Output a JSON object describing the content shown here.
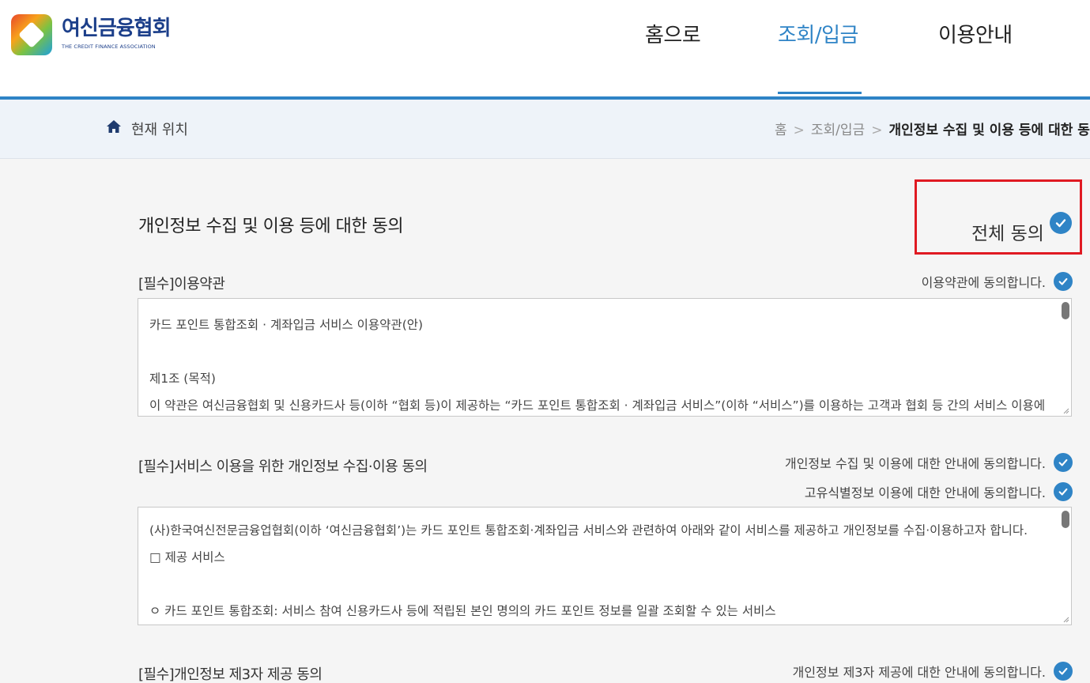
{
  "logo": {
    "name_ko": "여신금융협회",
    "name_en": "THE CREDIT FINANCE ASSOCIATION"
  },
  "nav": {
    "home": "홈으로",
    "inquiry": "조회/입금",
    "guide": "이용안내"
  },
  "breadcrumb": {
    "label": "현재 위치",
    "home": "홈",
    "sep": ">",
    "level1": "조회/입금",
    "current": "개인정보 수집 및 이용 등에 대한 동의"
  },
  "page": {
    "title": "개인정보 수집 및 이용 등에 대한 동의",
    "agree_all": "전체 동의"
  },
  "sections": [
    {
      "title": "[필수]이용약관",
      "agreements": [
        "이용약관에 동의합니다."
      ],
      "lines": [
        "카드 포인트 통합조회 · 계좌입금 서비스 이용약관(안)",
        "",
        "제1조 (목적)",
        "이 약관은 여신금융협회 및 신용카드사 등(이하 “협회 등)이 제공하는 “카드 포인트 통합조회 · 계좌입금 서비스”(이하 “서비스”)를 이용하는 고객과 협회 등 간의 서비스 이용에"
      ]
    },
    {
      "title": "[필수]서비스 이용을 위한 개인정보 수집·이용 동의",
      "agreements": [
        "개인정보 수집 및 이용에 대한 안내에 동의합니다.",
        "고유식별정보 이용에 대한 안내에 동의합니다."
      ],
      "lines": [
        "(사)한국여신전문금융업협회(이하 ‘여신금융협회’)는 카드 포인트 통합조회·계좌입금 서비스와 관련하여 아래와 같이 서비스를 제공하고 개인정보를 수집·이용하고자 합니다.",
        "□ 제공 서비스",
        "",
        " ㅇ 카드 포인트 통합조회: 서비스 참여 신용카드사 등에 적립된 본인 명의의 카드 포인트 정보를 일괄 조회할 수 있는 서비스"
      ]
    },
    {
      "title": "[필수]개인정보 제3자 제공 동의",
      "agreements": [
        "개인정보 제3자 제공에 대한 안내에 동의합니다."
      ]
    }
  ],
  "colors": {
    "accent": "#2f84c6",
    "highlight_border": "#e01a22",
    "logo_text": "#1c3f8a"
  }
}
